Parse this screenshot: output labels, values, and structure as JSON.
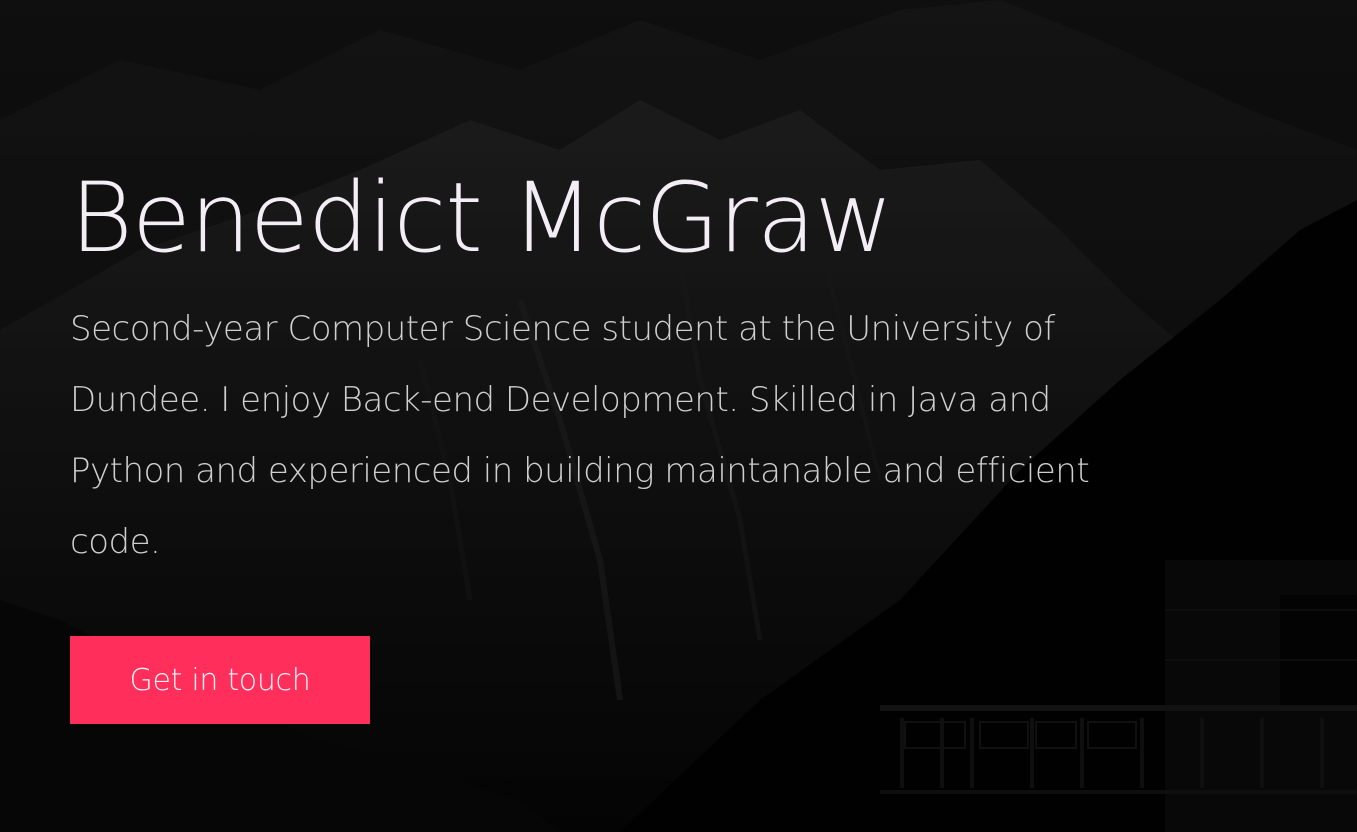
{
  "hero": {
    "name": "Benedict McGraw",
    "intro": "Second-year Computer Science student at the University of Dundee. I enjoy Back-end Development. Skilled in Java and Python and experienced in building maintanable and efficient code.",
    "cta_label": "Get in touch"
  },
  "colors": {
    "background": "#060606",
    "name_text": "#f3eef5",
    "body_text": "#cfcfcf",
    "accent": "#ff2e5b"
  }
}
